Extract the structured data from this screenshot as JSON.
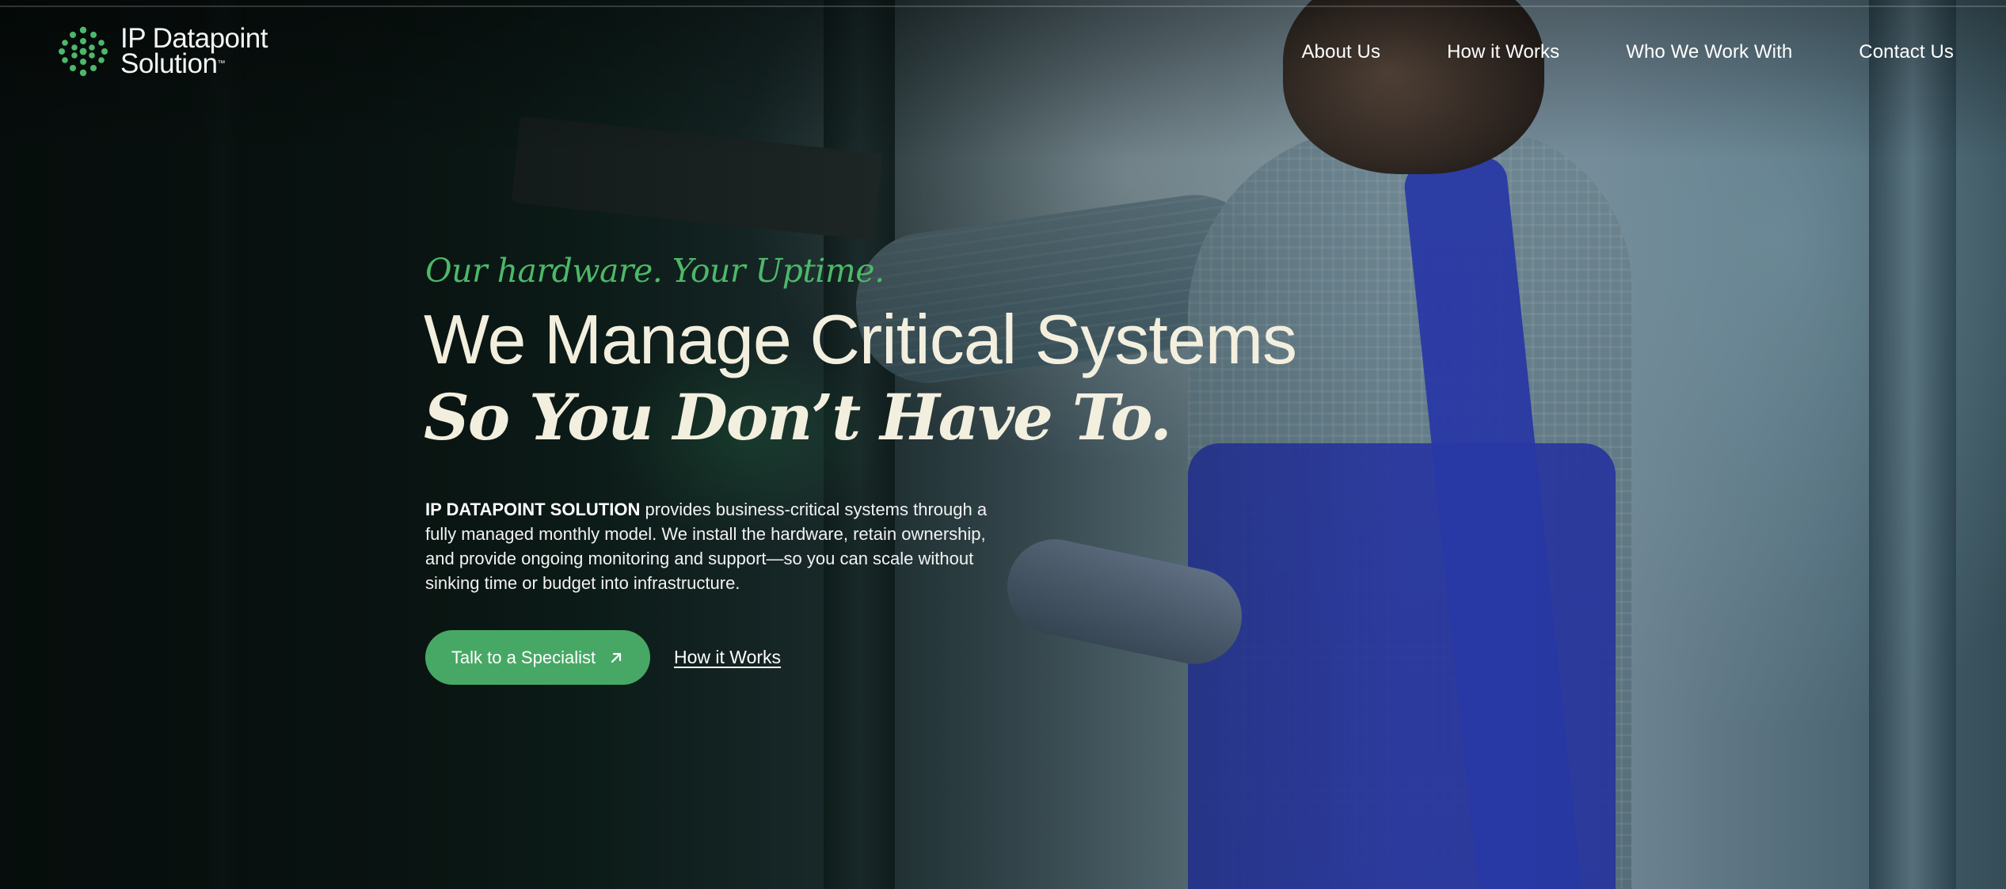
{
  "header": {
    "logo_line1": "IP Datapoint",
    "logo_line2": "Solution",
    "logo_tm": "™",
    "logo_color": "#4db86a"
  },
  "nav": {
    "items": [
      {
        "label": "About Us"
      },
      {
        "label": "How it Works"
      },
      {
        "label": "Who We Work With"
      },
      {
        "label": "Contact Us"
      }
    ]
  },
  "hero": {
    "tagline": "Our hardware. Your Uptime.",
    "headline_line1": "We Manage Critical Systems",
    "headline_line2": "So You Don’t Have To.",
    "body_strong": "IP DATAPOINT SOLUTION",
    "body_rest": " provides business-critical systems through a fully managed monthly model. We install the hardware, retain ownership, and provide ongoing monitoring and support—so you can scale without sinking time or budget into infrastructure.",
    "cta_label": "Talk to a Specialist",
    "cta_icon": "arrow-up-right-icon",
    "secondary_link": "How it Works"
  },
  "colors": {
    "accent": "#47a865",
    "tagline": "#4db86a",
    "headline": "#f3efdf"
  }
}
